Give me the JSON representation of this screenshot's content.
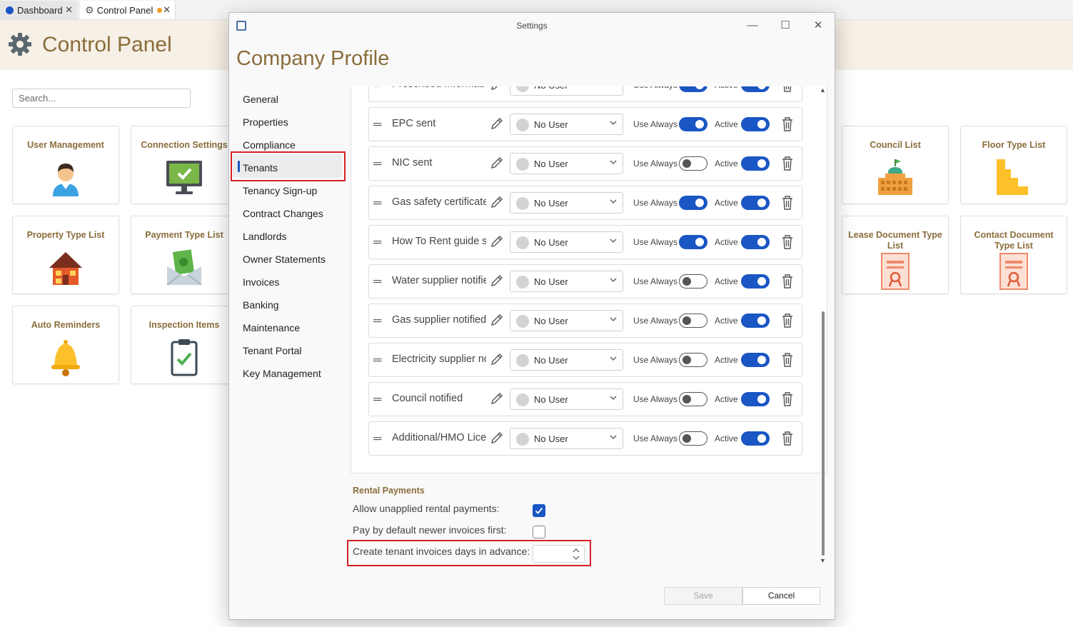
{
  "tabs": [
    {
      "label": "Dashboard"
    },
    {
      "label": "Control Panel"
    }
  ],
  "control_panel": {
    "title": "Control Panel",
    "search_placeholder": "Search...",
    "tiles": [
      {
        "label": "User Management",
        "icon": "user-icon"
      },
      {
        "label": "Connection Settings",
        "icon": "monitor-check-icon"
      },
      {
        "label": "Property Type List",
        "icon": "house-icon"
      },
      {
        "label": "Payment Type List",
        "icon": "money-envelope-icon"
      },
      {
        "label": "Auto Reminders",
        "icon": "bell-icon"
      },
      {
        "label": "Inspection Items",
        "icon": "clipboard-check-icon"
      },
      {
        "label": "Council List",
        "icon": "government-building-icon"
      },
      {
        "label": "Floor Type List",
        "icon": "stairs-icon"
      },
      {
        "label": "Lease Document Type List",
        "icon": "certificate-icon"
      },
      {
        "label": "Contact Document Type List",
        "icon": "certificate-icon"
      }
    ]
  },
  "dialog": {
    "window_title": "Settings",
    "heading": "Company Profile",
    "nav": [
      "General",
      "Properties",
      "Compliance",
      "Tenants",
      "Tenancy Sign-up",
      "Contract Changes",
      "Landlords",
      "Owner Statements",
      "Invoices",
      "Banking",
      "Maintenance",
      "Tenant Portal",
      "Key Management"
    ],
    "selected_nav": "Tenants",
    "row_labels": {
      "use_always": "Use Always",
      "active": "Active"
    },
    "rows": [
      {
        "name": "Prescribed Informatio",
        "user": "No User",
        "use_always": true,
        "active": true
      },
      {
        "name": "EPC sent",
        "user": "No User",
        "use_always": true,
        "active": true
      },
      {
        "name": "NIC sent",
        "user": "No User",
        "use_always": false,
        "active": true
      },
      {
        "name": "Gas safety certificate",
        "user": "No User",
        "use_always": true,
        "active": true
      },
      {
        "name": "How To Rent guide se",
        "user": "No User",
        "use_always": true,
        "active": true
      },
      {
        "name": "Water supplier notifie",
        "user": "No User",
        "use_always": false,
        "active": true
      },
      {
        "name": "Gas supplier notified",
        "user": "No User",
        "use_always": false,
        "active": true
      },
      {
        "name": "Electricity supplier no",
        "user": "No User",
        "use_always": false,
        "active": true
      },
      {
        "name": "Council notified",
        "user": "No User",
        "use_always": false,
        "active": true
      },
      {
        "name": "Additional/HMO Lice",
        "user": "No User",
        "use_always": false,
        "active": true
      }
    ],
    "rental_payments": {
      "heading": "Rental Payments",
      "allow_unapplied_label": "Allow unapplied rental payments:",
      "allow_unapplied": true,
      "pay_newer_first_label": "Pay by default newer invoices first:",
      "pay_newer_first": false,
      "days_in_advance_label": "Create tenant invoices days in advance:",
      "days_in_advance_value": ""
    },
    "buttons": {
      "save": "Save",
      "cancel": "Cancel"
    }
  },
  "colors": {
    "accent": "#1a56c4",
    "brand_text": "#8a6d3b",
    "highlight": "#d6202a",
    "header_bg": "#f6f0e6"
  }
}
